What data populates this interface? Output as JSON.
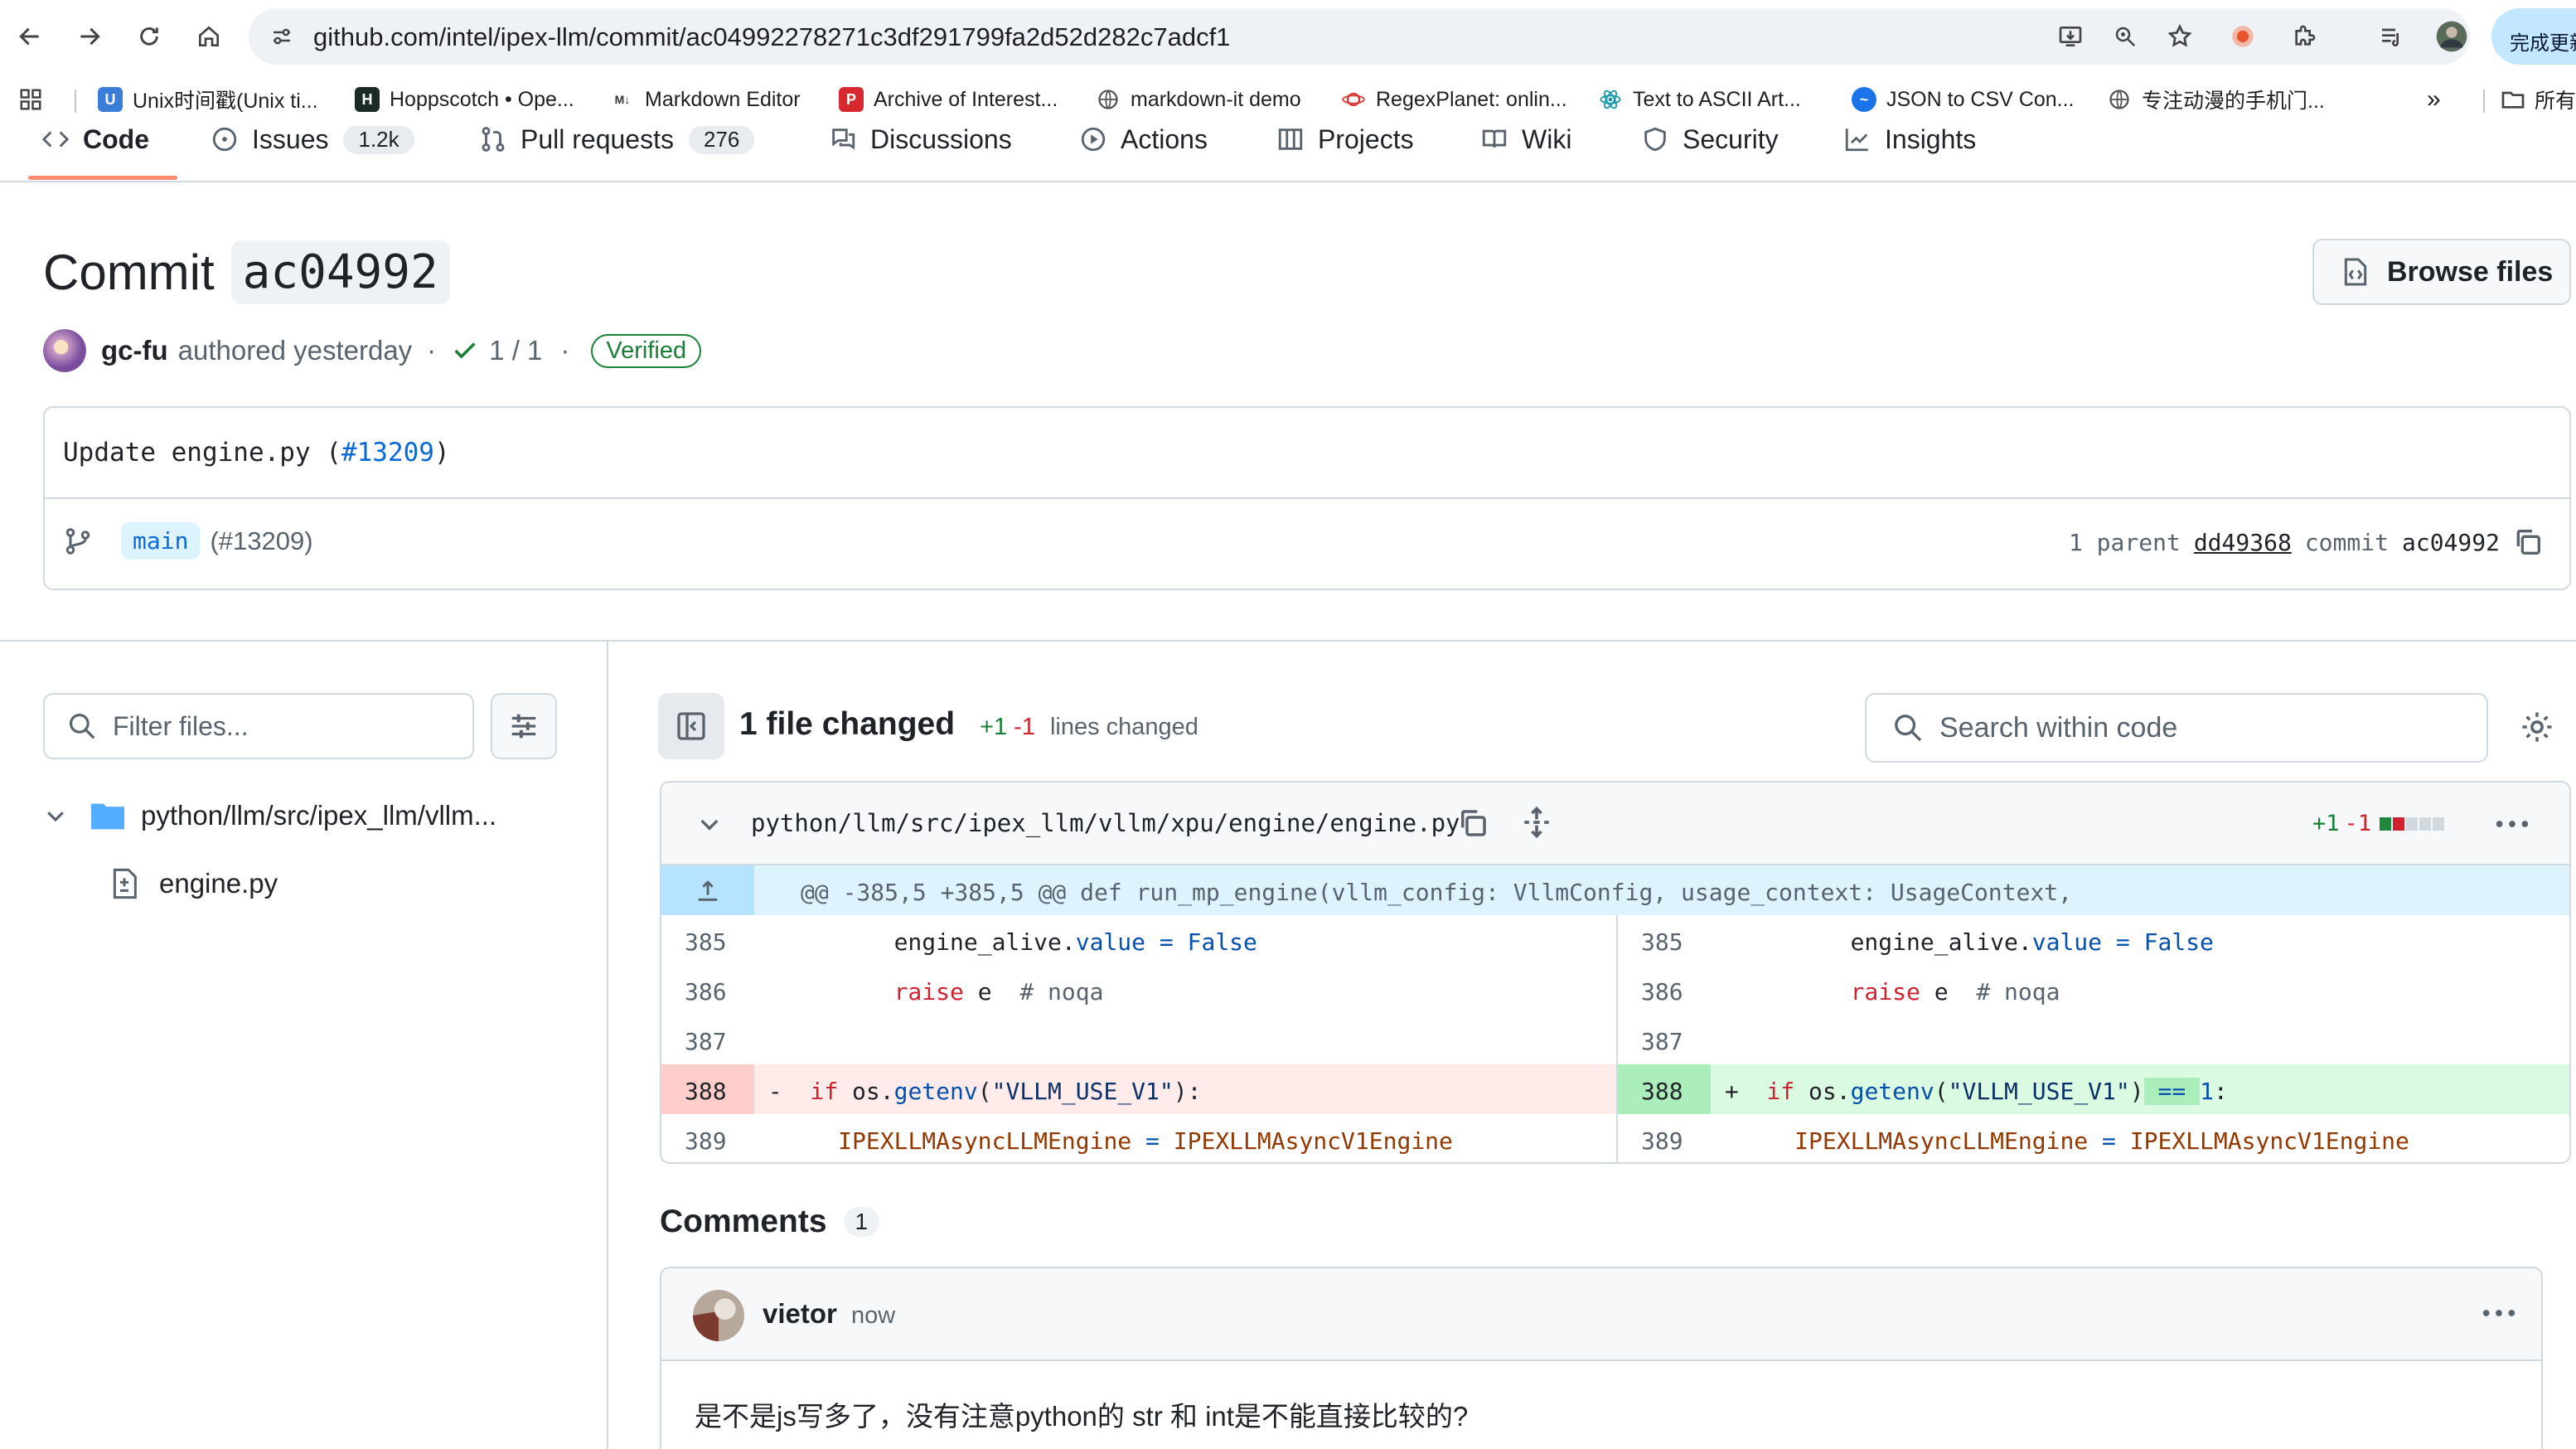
{
  "browser": {
    "url": "github.com/intel/ipex-llm/commit/ac04992278271c3df291799fa2d52d282c7adcf1",
    "update_button": "完成更新",
    "bookmarks": [
      {
        "label": "Unix时间戳(Unix ti...",
        "icon": "unix-timestamp-favicon"
      },
      {
        "label": "Hoppscotch • Ope...",
        "icon": "hoppscotch-favicon"
      },
      {
        "label": "Markdown Editor",
        "icon": "markdown-favicon"
      },
      {
        "label": "Archive of Interest...",
        "icon": "archive-favicon"
      },
      {
        "label": "markdown-it demo",
        "icon": "globe-icon"
      },
      {
        "label": "RegexPlanet: onlin...",
        "icon": "regexplanet-favicon"
      },
      {
        "label": "Text to ASCII Art...",
        "icon": "react-favicon"
      },
      {
        "label": "JSON to CSV Con...",
        "icon": "json-csv-favicon"
      },
      {
        "label": "专注动漫的手机门...",
        "icon": "globe-icon"
      }
    ],
    "bookmarks_overflow": "»",
    "all_bookmarks_label": "所有"
  },
  "repo_nav": {
    "tabs": [
      {
        "label": "Code",
        "count": ""
      },
      {
        "label": "Issues",
        "count": "1.2k"
      },
      {
        "label": "Pull requests",
        "count": "276"
      },
      {
        "label": "Discussions",
        "count": ""
      },
      {
        "label": "Actions",
        "count": ""
      },
      {
        "label": "Projects",
        "count": ""
      },
      {
        "label": "Wiki",
        "count": ""
      },
      {
        "label": "Security",
        "count": ""
      },
      {
        "label": "Insights",
        "count": ""
      }
    ]
  },
  "commit": {
    "title_prefix": "Commit",
    "short_sha": "ac04992",
    "browse_files": "Browse files",
    "author": "gc-fu",
    "authored_text": "authored yesterday",
    "sep": "·",
    "checks": "1 / 1",
    "verified": "Verified",
    "message_prefix": "Update engine.py (",
    "message_link": "#13209",
    "message_suffix": ")",
    "branch": "main",
    "branch_pr": "(#13209)",
    "parent_label": "1 parent",
    "parent_sha": "dd49368",
    "commit_label": "commit",
    "commit_sha": "ac04992"
  },
  "files": {
    "filter_placeholder": "Filter files...",
    "tree": [
      {
        "name": "python/llm/src/ipex_llm/vllm...",
        "type": "folder"
      },
      {
        "name": "engine.py",
        "type": "file"
      }
    ]
  },
  "diff": {
    "files_changed": "1 file changed",
    "additions": "+1",
    "deletions": "-1",
    "lines_changed": "lines changed",
    "search_placeholder": "Search within code",
    "file_path": "python/llm/src/ipex_llm/vllm/xpu/engine/engine.py",
    "hunk": "@@ -385,5 +385,5 @@ def run_mp_engine(vllm_config: VllmConfig, usage_context: UsageContext,",
    "line_numbers": [
      "385",
      "386",
      "387",
      "388",
      "389"
    ],
    "colors": {
      "added_bg": "#dafbe1",
      "added_num_bg": "#aceebb",
      "deleted_bg": "#ffebe9",
      "deleted_num_bg": "#ffcecb",
      "hunk_bg": "#ddf4ff"
    }
  },
  "comments": {
    "title": "Comments",
    "count": "1",
    "items": [
      {
        "author": "vietor",
        "time": "now",
        "body": "是不是js写多了，没有注意python的 str 和 int是不能直接比较的?"
      }
    ]
  }
}
